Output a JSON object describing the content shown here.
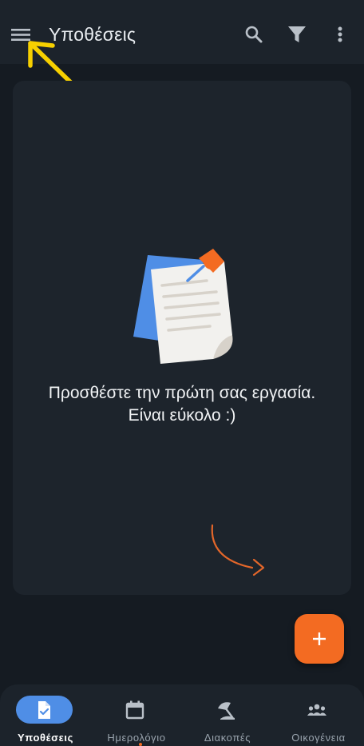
{
  "app_bar": {
    "title": "Υποθέσεις",
    "icons": [
      "menu-icon",
      "search-icon",
      "filter-icon",
      "more-vert-icon"
    ]
  },
  "empty_state": {
    "line1": "Προσθέστε την πρώτη σας εργασία.",
    "line2": "Είναι εύκολο :)"
  },
  "fab": {
    "icon": "plus-icon"
  },
  "bottom_nav": {
    "items": [
      {
        "label": "Υποθέσεις",
        "icon": "task-check-icon",
        "active": true
      },
      {
        "label": "Ημερολόγιο",
        "icon": "calendar-icon",
        "active": false
      },
      {
        "label": "Διακοπές",
        "icon": "beach-umbrella-icon",
        "active": false
      },
      {
        "label": "Οικογένεια",
        "icon": "family-icon",
        "active": false
      }
    ]
  },
  "colors": {
    "background": "#151b22",
    "surface": "#1d242c",
    "accent_orange": "#f36b22",
    "active_blue": "#4f8ee6",
    "annotation_yellow": "#f6d000"
  }
}
